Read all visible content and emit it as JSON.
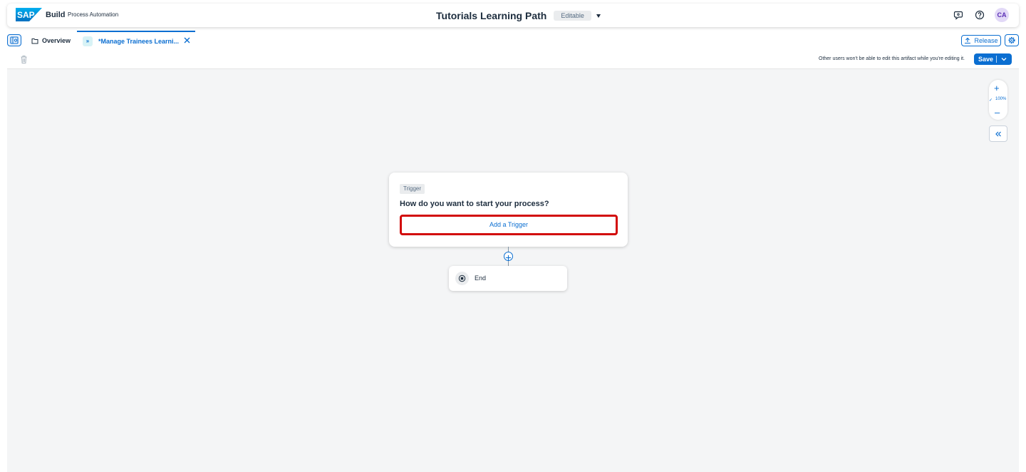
{
  "shellbar": {
    "logo_text": "SAP",
    "brand": "Build",
    "product": "Process Automation",
    "project_title": "Tutorials Learning Path",
    "status_tag": "Editable",
    "avatar_initials": "CA",
    "icons": [
      "feedback-icon",
      "help-icon"
    ]
  },
  "tabs": [
    {
      "label": "Overview",
      "icon": "folder-icon"
    },
    {
      "label": "*Manage Trainees Learni...",
      "icon": "process-icon",
      "active": true
    }
  ],
  "header_actions": {
    "release_label": "Release"
  },
  "toolbar": {
    "lock_message": "Other users won't be able to edit this artifact while you're editing it.",
    "save_label": "Save"
  },
  "canvas": {
    "zoom_level": "100%",
    "trigger": {
      "tag": "Trigger",
      "question": "How do you want to start your process?",
      "add_label": "Add a Trigger"
    },
    "end_label": "End"
  },
  "colors": {
    "accent": "#0a6ed1",
    "highlight": "#d20a0a",
    "canvas_bg": "#f4f5f6"
  }
}
